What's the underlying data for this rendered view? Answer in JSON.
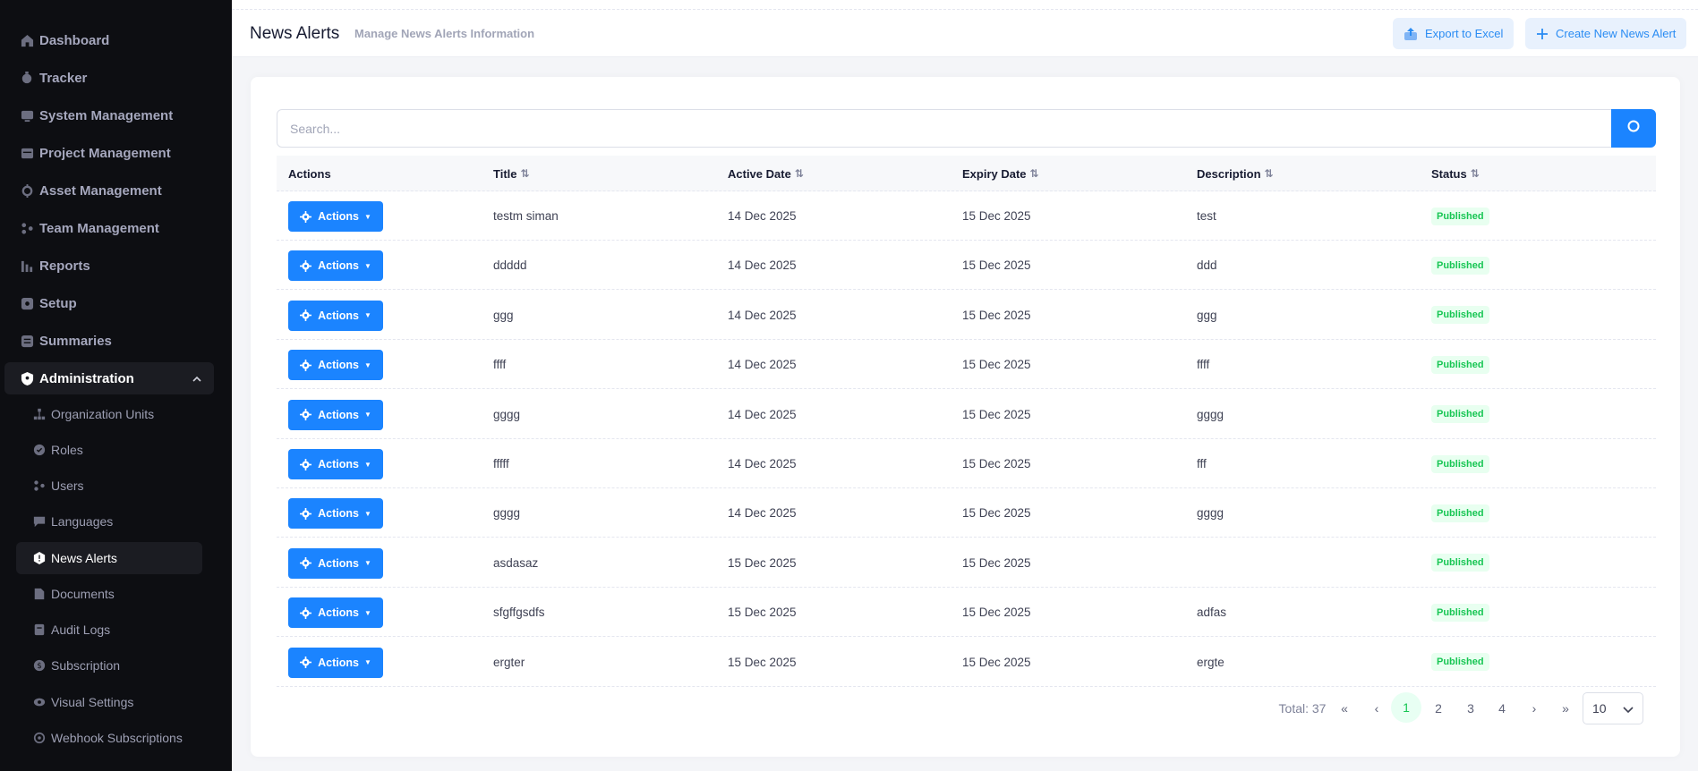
{
  "sidebar": {
    "items": [
      {
        "label": "Dashboard",
        "icon": "home-icon"
      },
      {
        "label": "Tracker",
        "icon": "tracker-icon"
      },
      {
        "label": "System Management",
        "icon": "system-icon"
      },
      {
        "label": "Project Management",
        "icon": "project-icon"
      },
      {
        "label": "Asset Management",
        "icon": "asset-icon"
      },
      {
        "label": "Team Management",
        "icon": "team-icon"
      },
      {
        "label": "Reports",
        "icon": "chart-icon"
      },
      {
        "label": "Setup",
        "icon": "setup-icon"
      },
      {
        "label": "Summaries",
        "icon": "summary-icon"
      },
      {
        "label": "Administration",
        "icon": "shield-icon"
      }
    ],
    "admin_sub": [
      {
        "label": "Organization Units",
        "icon": "org-icon"
      },
      {
        "label": "Roles",
        "icon": "roles-icon"
      },
      {
        "label": "Users",
        "icon": "users-icon"
      },
      {
        "label": "Languages",
        "icon": "language-icon"
      },
      {
        "label": "News Alerts",
        "icon": "alert-icon"
      },
      {
        "label": "Documents",
        "icon": "document-icon"
      },
      {
        "label": "Audit Logs",
        "icon": "audit-icon"
      },
      {
        "label": "Subscription",
        "icon": "subscription-icon"
      },
      {
        "label": "Visual Settings",
        "icon": "eye-icon"
      },
      {
        "label": "Webhook Subscriptions",
        "icon": "webhook-icon"
      }
    ]
  },
  "header": {
    "title": "News Alerts",
    "subtitle": "Manage News Alerts Information",
    "export_label": "Export to Excel",
    "create_label": "Create New News Alert"
  },
  "search": {
    "placeholder": "Search..."
  },
  "table": {
    "columns": [
      "Actions",
      "Title",
      "Active Date",
      "Expiry Date",
      "Description",
      "Status"
    ],
    "action_label": "Actions",
    "rows": [
      {
        "title": "testm siman",
        "active": "14 Dec 2025",
        "expiry": "15 Dec 2025",
        "desc": "test",
        "status": "Published"
      },
      {
        "title": "ddddd",
        "active": "14 Dec 2025",
        "expiry": "15 Dec 2025",
        "desc": "ddd",
        "status": "Published"
      },
      {
        "title": "ggg",
        "active": "14 Dec 2025",
        "expiry": "15 Dec 2025",
        "desc": "ggg",
        "status": "Published"
      },
      {
        "title": "ffff",
        "active": "14 Dec 2025",
        "expiry": "15 Dec 2025",
        "desc": "ffff",
        "status": "Published"
      },
      {
        "title": "gggg",
        "active": "14 Dec 2025",
        "expiry": "15 Dec 2025",
        "desc": "gggg",
        "status": "Published"
      },
      {
        "title": "fffff",
        "active": "14 Dec 2025",
        "expiry": "15 Dec 2025",
        "desc": "fff",
        "status": "Published"
      },
      {
        "title": "gggg",
        "active": "14 Dec 2025",
        "expiry": "15 Dec 2025",
        "desc": "gggg",
        "status": "Published"
      },
      {
        "title": "asdasaz",
        "active": "15 Dec 2025",
        "expiry": "15 Dec 2025",
        "desc": "",
        "status": "Published"
      },
      {
        "title": "sfgffgsdfs",
        "active": "15 Dec 2025",
        "expiry": "15 Dec 2025",
        "desc": "adfas",
        "status": "Published"
      },
      {
        "title": "ergter",
        "active": "15 Dec 2025",
        "expiry": "15 Dec 2025",
        "desc": "ergte",
        "status": "Published"
      }
    ]
  },
  "pagination": {
    "total": "Total: 37",
    "pages": [
      "1",
      "2",
      "3",
      "4"
    ],
    "current": "1",
    "page_size": "10"
  },
  "colors": {
    "primary": "#1b84ff",
    "success": "#17c653",
    "sidebar_bg": "#0d0e12"
  }
}
